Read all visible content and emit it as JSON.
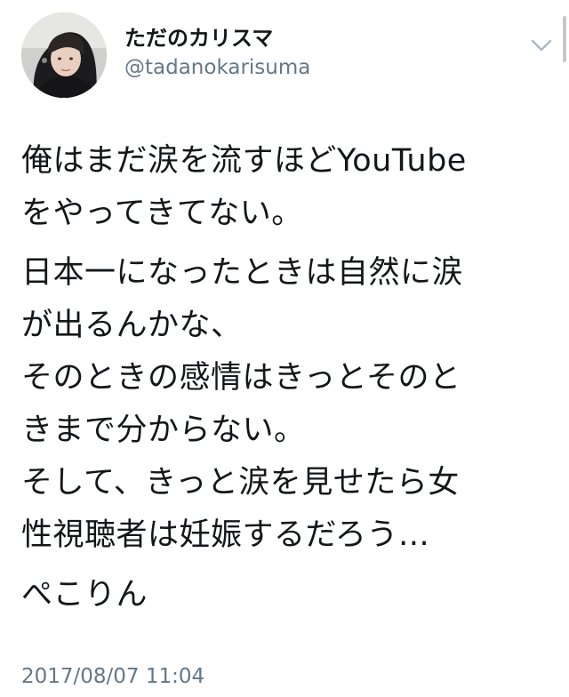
{
  "author": {
    "display_name": "ただのカリスマ",
    "handle": "@tadanokarisuma",
    "avatar_icon": "avatar-photo"
  },
  "menu": {
    "icon": "chevron-down-icon"
  },
  "tweet": {
    "paragraphs": [
      {
        "lines": [
          "俺はまだ涙を流すほどYouTube",
          "をやってきてない。"
        ]
      },
      {
        "lines": [
          "日本一になったときは自然に涙",
          "が出るんかな、",
          "そのときの感情はきっとそのと",
          "きまで分からない。",
          "そして、きっと涙を見せたら女",
          "性視聴者は妊娠するだろう…"
        ]
      },
      {
        "lines": [
          "ぺこりん"
        ]
      }
    ],
    "timestamp": "2017/08/07 11:04"
  },
  "colors": {
    "text": "#14171a",
    "secondary": "#657786",
    "background": "#ffffff"
  }
}
